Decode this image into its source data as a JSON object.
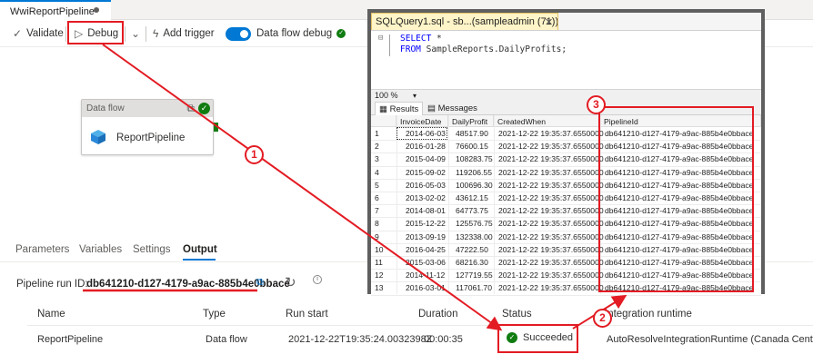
{
  "adf": {
    "tab_title": "WwiReportPipeline",
    "toolbar": {
      "validate": "Validate",
      "debug": "Debug",
      "add_trigger": "Add trigger",
      "dataflow_debug": "Data flow debug"
    },
    "activity": {
      "type": "Data flow",
      "name": "ReportPipeline"
    },
    "bottom_tabs": [
      "Parameters",
      "Variables",
      "Settings",
      "Output"
    ],
    "active_tab": "Output",
    "run_id_label": "Pipeline run ID:",
    "run_id": "db641210-d127-4179-a9ac-885b4e0bbace",
    "table": {
      "headers": [
        "Name",
        "Type",
        "Run start",
        "Duration",
        "Status",
        "Integration runtime"
      ],
      "row": {
        "name": "ReportPipeline",
        "type": "Data flow",
        "run_start": "2021-12-22T19:35:24.0032398Z",
        "duration": "00:00:35",
        "status": "Succeeded",
        "runtime": "AutoResolveIntegrationRuntime (Canada Central)"
      }
    }
  },
  "ssms": {
    "tab_title": "SQLQuery1.sql - sb...(sampleadmin (71))*",
    "query": {
      "line1_kw": "SELECT",
      "line1_rest": " *",
      "line2_kw": "FROM",
      "line2_rest": " SampleReports.DailyProfits;"
    },
    "zoom": "100 %",
    "result_tabs": [
      "Results",
      "Messages"
    ],
    "columns": [
      "InvoiceDate",
      "DailyProfit",
      "CreatedWhen",
      "PipelineId"
    ],
    "rows": [
      [
        "1",
        "2014-06-03",
        "48517.90",
        "2021-12-22 19:35:37.6550000",
        "db641210-d127-4179-a9ac-885b4e0bbace"
      ],
      [
        "2",
        "2016-01-28",
        "76600.15",
        "2021-12-22 19:35:37.6550000",
        "db641210-d127-4179-a9ac-885b4e0bbace"
      ],
      [
        "3",
        "2015-04-09",
        "108283.75",
        "2021-12-22 19:35:37.6550000",
        "db641210-d127-4179-a9ac-885b4e0bbace"
      ],
      [
        "4",
        "2015-09-02",
        "119206.55",
        "2021-12-22 19:35:37.6550000",
        "db641210-d127-4179-a9ac-885b4e0bbace"
      ],
      [
        "5",
        "2016-05-03",
        "100696.30",
        "2021-12-22 19:35:37.6550000",
        "db641210-d127-4179-a9ac-885b4e0bbace"
      ],
      [
        "6",
        "2013-02-02",
        "43612.15",
        "2021-12-22 19:35:37.6550000",
        "db641210-d127-4179-a9ac-885b4e0bbace"
      ],
      [
        "7",
        "2014-08-01",
        "64773.75",
        "2021-12-22 19:35:37.6550000",
        "db641210-d127-4179-a9ac-885b4e0bbace"
      ],
      [
        "8",
        "2015-12-22",
        "125576.75",
        "2021-12-22 19:35:37.6550000",
        "db641210-d127-4179-a9ac-885b4e0bbace"
      ],
      [
        "9",
        "2013-09-19",
        "132338.00",
        "2021-12-22 19:35:37.6550000",
        "db641210-d127-4179-a9ac-885b4e0bbace"
      ],
      [
        "10",
        "2016-04-25",
        "47222.50",
        "2021-12-22 19:35:37.6550000",
        "db641210-d127-4179-a9ac-885b4e0bbace"
      ],
      [
        "11",
        "2015-03-06",
        "68216.30",
        "2021-12-22 19:35:37.6550000",
        "db641210-d127-4179-a9ac-885b4e0bbace"
      ],
      [
        "12",
        "2014-11-12",
        "127719.55",
        "2021-12-22 19:35:37.6550000",
        "db641210-d127-4179-a9ac-885b4e0bbace"
      ],
      [
        "13",
        "2016-03-01",
        "117061.70",
        "2021-12-22 19:35:37.6550000",
        "db641210-d127-4179-a9ac-885b4e0bbace"
      ]
    ]
  },
  "callouts": [
    "1",
    "2",
    "3"
  ],
  "colors": {
    "accent": "#0078d4",
    "success": "#107c10",
    "annotation": "#e31b23"
  }
}
